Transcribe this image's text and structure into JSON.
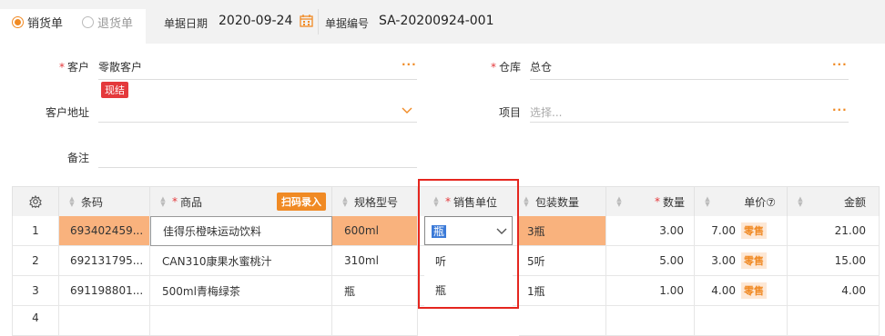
{
  "header": {
    "sale_label": "销货单",
    "return_label": "退货单",
    "date_label": "单据日期",
    "date_value": "2020-09-24",
    "number_label": "单据编号",
    "number_value": "SA-20200924-001"
  },
  "form": {
    "customer_label": "客户",
    "customer_value": "零散客户",
    "cash_badge": "现结",
    "address_label": "客户地址",
    "remark_label": "备注",
    "warehouse_label": "仓库",
    "warehouse_value": "总仓",
    "project_label": "项目",
    "project_placeholder": "选择..."
  },
  "table": {
    "headers": {
      "barcode": "条码",
      "product": "商品",
      "scan": "扫码录入",
      "spec": "规格型号",
      "unit": "销售单位",
      "package": "包装数量",
      "qty": "数量",
      "price": "单价⑦",
      "amount": "金额"
    },
    "rows": [
      {
        "no": "1",
        "barcode": "693402459...",
        "product": "佳得乐橙味运动饮料",
        "spec": "600ml",
        "unit": "瓶",
        "package": "3瓶",
        "qty": "3.00",
        "price": "7.00",
        "tag": "零售",
        "amount": "21.00"
      },
      {
        "no": "2",
        "barcode": "692131795...",
        "product": "CAN310康果水蜜桃汁",
        "spec": "310ml",
        "unit": "",
        "package": "5听",
        "qty": "5.00",
        "price": "3.00",
        "tag": "零售",
        "amount": "15.00"
      },
      {
        "no": "3",
        "barcode": "691198801...",
        "product": "500ml青梅绿茶",
        "spec": "瓶",
        "unit": "",
        "package": "1瓶",
        "qty": "1.00",
        "price": "4.00",
        "tag": "零售",
        "amount": "4.00"
      },
      {
        "no": "4"
      }
    ],
    "dropdown_options": [
      "听",
      "瓶"
    ]
  }
}
